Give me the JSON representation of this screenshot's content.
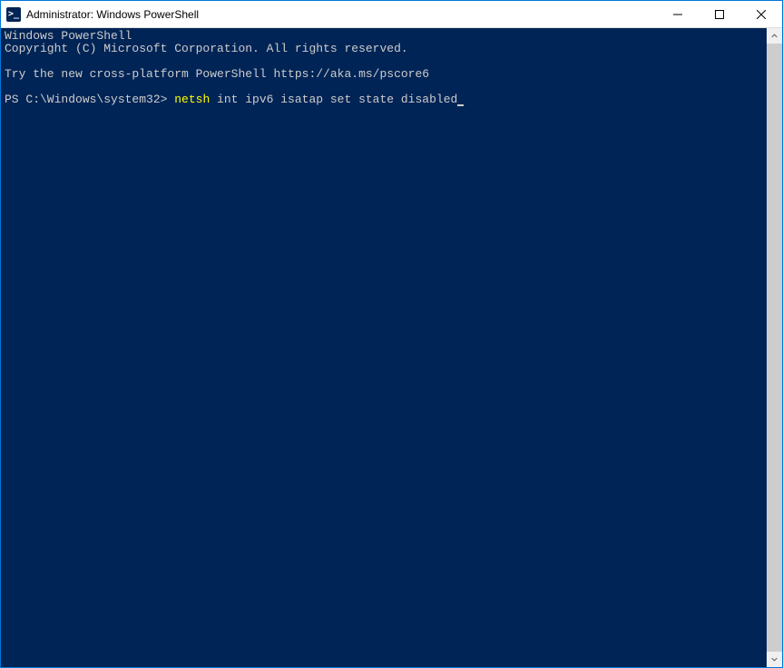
{
  "window": {
    "title": "Administrator: Windows PowerShell"
  },
  "terminal": {
    "line1": "Windows PowerShell",
    "line2": "Copyright (C) Microsoft Corporation. All rights reserved.",
    "line3": "Try the new cross-platform PowerShell https://aka.ms/pscore6",
    "prompt": "PS C:\\Windows\\system32> ",
    "command_part1": "netsh ",
    "command_part2": "int ipv6 isatap set state disabled"
  },
  "colors": {
    "terminal_bg": "#012456",
    "terminal_fg": "#cccccc",
    "command_highlight": "#ffff00"
  }
}
